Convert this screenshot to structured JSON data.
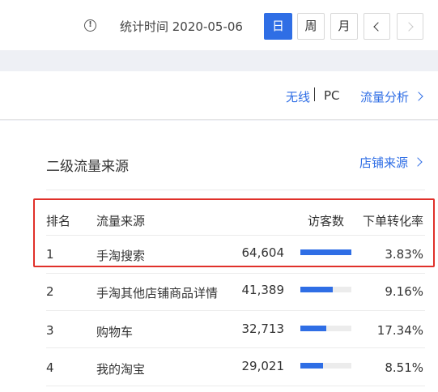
{
  "header": {
    "stat_time": "统计时间 2020-05-06",
    "buttons": [
      "日",
      "周",
      "月"
    ],
    "active": "日"
  },
  "subnav": {
    "wireless": "无线",
    "pc": "PC",
    "traffic_analysis": "流量分析"
  },
  "section": {
    "title": "二级流量来源",
    "store_source_link": "店铺来源"
  },
  "table": {
    "columns": [
      "排名",
      "流量来源",
      "访客数",
      "下单转化率"
    ],
    "rows": [
      {
        "rank": "1",
        "source": "手淘搜索",
        "visitors": "64,604",
        "share": 1.0,
        "rate": "3.83%"
      },
      {
        "rank": "2",
        "source": "手淘其他店铺商品详情",
        "visitors": "41,389",
        "share": 0.64,
        "rate": "9.16%"
      },
      {
        "rank": "3",
        "source": "购物车",
        "visitors": "32,713",
        "share": 0.51,
        "rate": "17.34%"
      },
      {
        "rank": "4",
        "source": "我的淘宝",
        "visitors": "29,021",
        "share": 0.45,
        "rate": "8.51%"
      }
    ]
  }
}
